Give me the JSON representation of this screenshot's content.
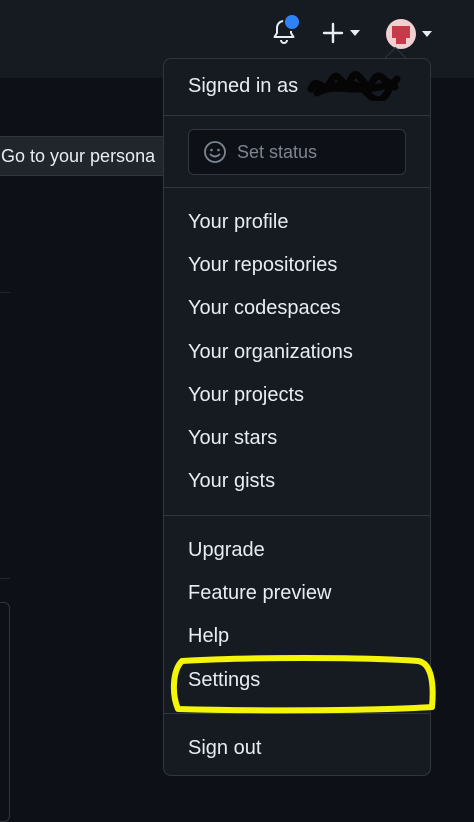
{
  "header": {
    "icons": [
      "bell-icon",
      "plus-icon",
      "avatar"
    ],
    "notification_dot_color": "#2f81f7"
  },
  "background": {
    "goto_label": "Go to your persona"
  },
  "menu": {
    "signed_in_label": "Signed in as",
    "set_status_label": "Set status",
    "profile_items": [
      "Your profile",
      "Your repositories",
      "Your codespaces",
      "Your organizations",
      "Your projects",
      "Your stars",
      "Your gists"
    ],
    "extra_items": [
      "Upgrade",
      "Feature preview",
      "Help",
      "Settings"
    ],
    "sign_out_label": "Sign out",
    "highlight_color": "#f5f50a"
  }
}
